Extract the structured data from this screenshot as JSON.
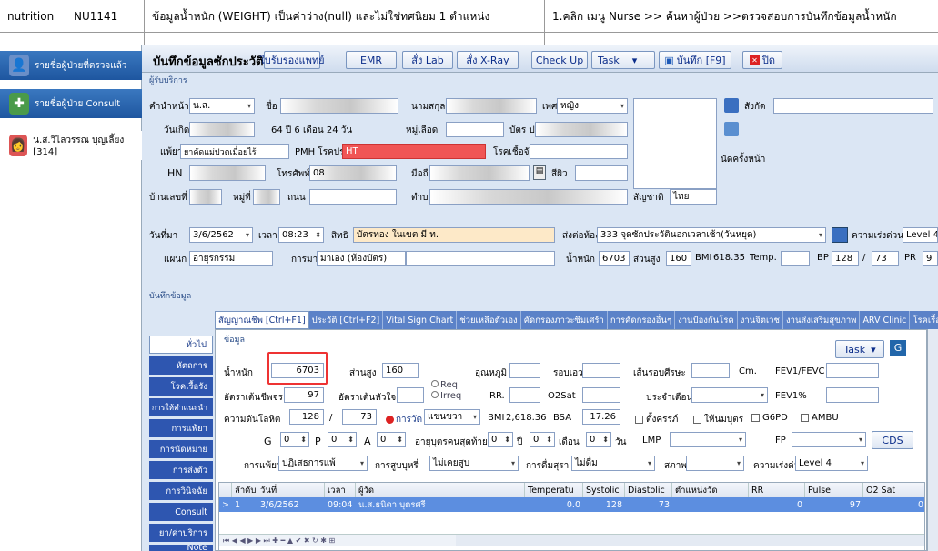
{
  "topbar": {
    "category": "nutrition",
    "code": "NU1141",
    "issue": "ข้อมูลน้ำหนัก (WEIGHT) เป็นค่าว่าง(null) และไม่ใช่ทศนิยม 1 ตำแหน่ง",
    "steps": "1.คลิก เมนู Nurse >> ค้นหาผู้ป่วย >>ตรวจสอบการบันทึกข้อมูลน้ำหนัก"
  },
  "left": {
    "items": [
      {
        "label": "รายชื่อผู้ป่วยที่ตรวจแล้ว",
        "icon": "patient-icon"
      },
      {
        "label": "รายชื่อผู้ป่วย Consult",
        "icon": "consult-icon"
      },
      {
        "label": "น.ส.วิไลวรรณ บุญเลี้ยง [314]",
        "icon": "nurse-icon"
      }
    ]
  },
  "toolbar": {
    "title": "บันทึกข้อมูลซักประวัติ",
    "buttons": [
      "ใบรับรองแพทย์",
      "EMR",
      "สั่ง Lab",
      "สั่ง X-Ray",
      "Check Up",
      "Task",
      "บันทึก [F9]",
      "ปิด"
    ]
  },
  "patient": {
    "section": "ผู้รับบริการ",
    "prefix_label": "คำนำหน้า",
    "prefix": "น.ส.",
    "name_label": "ชื่อ",
    "surname_label": "นามสกุล",
    "sex_label": "เพศ",
    "sex": "หญิง",
    "dept_label": "สังกัด",
    "dob_label": "วันเกิด",
    "age_unit": "ปี",
    "age": "64 ปี 6 เดือน 24 วัน",
    "bloodgroup_label": "หมู่เลือด",
    "cid_label": "บัตร ปชช.",
    "allergy_label": "แพ้ยา",
    "allergy": "ยาคัดแม่ปวดเมื่อยไร้",
    "pmh_label": "PMH โรคประจำตัว",
    "pmh": "HT",
    "contagious_label": "โรคเชื้อจัง",
    "appt_label": "นัดครั้งหน้า",
    "hn_label": "HN",
    "phone_label": "โทรศัพท์",
    "phone": "08",
    "mobile_label": "มือถือ",
    "color_label": "สีผิว",
    "address_label": "บ้านเลขที่",
    "moo_label": "หมู่ที่",
    "road_label": "ถนน",
    "tambon_label": "ตำบล",
    "nation_label": "สัญชาติ",
    "nation": "ไทย"
  },
  "visit": {
    "date_label": "วันที่มา",
    "date": "3/6/2562",
    "time_label": "เวลา",
    "time": "08:23",
    "right_label": "สิทธิ",
    "right": "บัตรทอง ในเขต มี ท.",
    "send_label": "ส่งต่อห้อง",
    "send": "333 จุดซักประวัตินอกเวลาเช้า(วันหยุด)",
    "urgency_label": "ความเร่งด่วน",
    "urgency": "Level 4",
    "dept_label": "แผนก",
    "dept": "อายุรกรรม",
    "come_label": "การมา",
    "come": "มาเอง (ห้องบัตร)",
    "weight_label": "น้ำหนัก",
    "weight": "6703",
    "height_label": "ส่วนสูง",
    "height": "160",
    "bmi_label": "BMI",
    "bmi": "618.35",
    "temp_label": "Temp.",
    "bp_label": "BP",
    "bp_sys": "128",
    "bp_dia": "73",
    "pr_label": "PR",
    "pr": "9"
  },
  "record": {
    "section": "บันทึกข้อมูล",
    "side_tabs": [
      "ทั่วไป",
      "หัตถการ",
      "โรคเรื้อรัง",
      "การให้คำแนะนำ",
      "การแพ้ยา",
      "การนัดหมาย",
      "การส่งตัว",
      "การวินิจฉัย",
      "Consult",
      "ยา/ค่าบริการ",
      "Note"
    ],
    "tabs": [
      "สัญญาณชีพ [Ctrl+F1]",
      "ประวัติ [Ctrl+F2]",
      "Vital Sign Chart",
      "ช่วยเหลือตัวเอง",
      "คัดกรองภาวะซึมเศร้า",
      "การคัดกรองอื่นๆ",
      "งานป้องกันโรค",
      "งานจิตเวช",
      "งานส่งเสริมสุขภาพ",
      "ARV Clinic",
      "โรคเรื้อ"
    ],
    "data_label": "ข้อมูล",
    "task": "Task",
    "weight_label": "น้ำหนัก",
    "weight": "6703",
    "height_label": "ส่วนสูง",
    "height": "160",
    "temp_label": "อุณหภูมิ",
    "waist_label": "รอบเอว",
    "head_label": "เส้นรอบศีรษะ",
    "cm": "Cm.",
    "fev1fvc": "FEV1/FEVC",
    "rr_label": "อัตราเต้นชีพจร",
    "rr": "97",
    "hr_label": "อัตราเต้นหัวใจ",
    "req": "Req",
    "irreq": "Irreq",
    "rr2": "RR.",
    "o2sat": "O2Sat",
    "period_label": "ประจำเดือน",
    "fev1": "FEV1%",
    "bp_label": "ความดันโลหิต",
    "bp_sys": "128",
    "bp_dia": "73",
    "bp_method": "การวัด",
    "bp_side": "แขนขวา",
    "bmi_label": "BMI",
    "bmi": "2,618.36",
    "bsa_label": "BSA",
    "bsa": "17.26",
    "pregnant": "ตั้งครรภ์",
    "breastfeed": "ให้นมบุตร",
    "g6pd": "G6PD",
    "ambu": "AMBU",
    "g_label": "G",
    "g": "0",
    "p_label": "P",
    "p": "0",
    "a_label": "A",
    "a": "0",
    "lastchild_label": "อายุบุตรคนสุดท้าย",
    "year": "0",
    "year_label": "ปี",
    "month": "0",
    "month_label": "เดือน",
    "day": "0",
    "day_label": "วัน",
    "lmp_label": "LMP",
    "fp_label": "FP",
    "cds": "CDS",
    "allergy_label": "การแพ้ยา",
    "allergy": "ปฏิเสธการแพ้",
    "smoke_label": "การสูบบุหรี่",
    "smoke": "ไม่เคยสูบ",
    "drink_label": "การดื่มสุรา",
    "drink": "ไม่ดื่ม",
    "status_label": "สภาพ",
    "urgency_label": "ความเร่งด่วน",
    "urgency": "Level 4"
  },
  "grid": {
    "headers": [
      "ลำดับ",
      "วันที่",
      "เวลา",
      "ผู้วัด",
      "Temperatu",
      "Systolic",
      "Diastolic",
      "ตำแหน่งวัด",
      "RR",
      "Pulse",
      "O2 Sat"
    ],
    "row": [
      "1",
      "3/6/2562",
      "09:04",
      "น.ส.ธนิดา บุตรศรี",
      "0.0",
      "128",
      "73",
      "",
      "0",
      "97",
      "0"
    ]
  }
}
